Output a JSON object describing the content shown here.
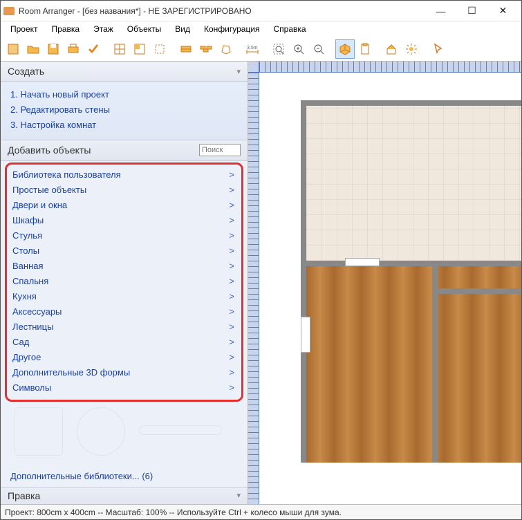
{
  "title": "Room Arranger - [без названия*] - НЕ ЗАРЕГИСТРИРОВАНО",
  "menu": [
    "Проект",
    "Правка",
    "Этаж",
    "Объекты",
    "Вид",
    "Конфигурация",
    "Справка"
  ],
  "toolbar_icons": [
    "new",
    "open",
    "save",
    "print",
    "tick",
    "sep",
    "grid1",
    "grid2",
    "select",
    "sep",
    "wall1",
    "wall2",
    "polygon",
    "sep",
    "dim",
    "sep",
    "zoom-fit",
    "zoom-in",
    "zoom-out",
    "sep",
    "view3d",
    "clipboard",
    "sep",
    "shop",
    "effects",
    "sep",
    "cursor"
  ],
  "panel_create": "Создать",
  "steps": [
    "1. Начать новый проект",
    "2. Редактировать стены",
    "3. Настройка комнат"
  ],
  "addobj": "Добавить объекты",
  "search_placeholder": "Поиск",
  "categories": [
    "Библиотека пользователя",
    "Простые объекты",
    "Двери и окна",
    "Шкафы",
    "Стулья",
    "Столы",
    "Ванная",
    "Спальня",
    "Кухня",
    "Аксессуары",
    "Лестницы",
    "Сад",
    "Другое",
    "Дополнительные 3D формы",
    "Символы"
  ],
  "more_libs": "Дополнительные библиотеки... (6)",
  "edit_header": "Правка",
  "status": "Проект: 800cm x 400cm -- Масштаб: 100% -- Используйте Ctrl + колесо мыши для зума."
}
